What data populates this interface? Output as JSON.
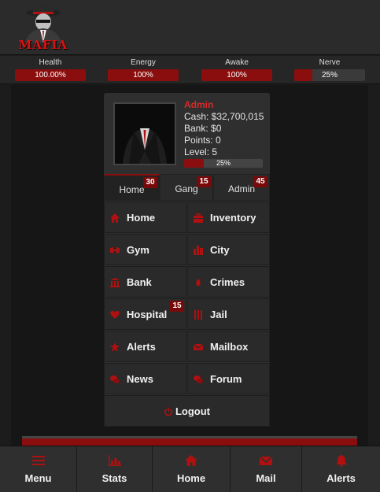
{
  "header": {
    "logo_text": "MAFIA"
  },
  "stats": [
    {
      "label": "Health",
      "value_text": "100.00%",
      "fill": 1.0
    },
    {
      "label": "Energy",
      "value_text": "100%",
      "fill": 1.0
    },
    {
      "label": "Awake",
      "value_text": "100%",
      "fill": 1.0
    },
    {
      "label": "Nerve",
      "value_text": "25%",
      "fill": 0.25
    }
  ],
  "profile": {
    "name": "Admin",
    "cash": "Cash: $32,700,015",
    "bank": "Bank: $0",
    "points": "Points: 0",
    "level": "Level: 5",
    "level_progress_text": "25%",
    "level_progress": 0.25
  },
  "tabs": [
    {
      "label": "Home",
      "badge": "30",
      "active": true
    },
    {
      "label": "Gang",
      "badge": "15",
      "active": false
    },
    {
      "label": "Admin",
      "badge": "45",
      "active": false
    }
  ],
  "menu": [
    {
      "label": "Home",
      "icon": "home-icon"
    },
    {
      "label": "Inventory",
      "icon": "briefcase-icon"
    },
    {
      "label": "Gym",
      "icon": "dumbbell-icon"
    },
    {
      "label": "City",
      "icon": "city-icon"
    },
    {
      "label": "Bank",
      "icon": "bank-icon"
    },
    {
      "label": "Crimes",
      "icon": "crime-icon"
    },
    {
      "label": "Hospital",
      "icon": "hospital-icon",
      "badge": "15"
    },
    {
      "label": "Jail",
      "icon": "jail-icon"
    },
    {
      "label": "Alerts",
      "icon": "alert-icon"
    },
    {
      "label": "Mailbox",
      "icon": "mail-icon"
    },
    {
      "label": "News",
      "icon": "news-icon"
    },
    {
      "label": "Forum",
      "icon": "forum-icon"
    }
  ],
  "logout": {
    "label": "Logout",
    "icon": "power-icon"
  },
  "bottom_nav": [
    {
      "label": "Menu",
      "icon": "menu-icon"
    },
    {
      "label": "Stats",
      "icon": "stats-icon"
    },
    {
      "label": "Home",
      "icon": "home-icon"
    },
    {
      "label": "Mail",
      "icon": "mail-icon"
    },
    {
      "label": "Alerts",
      "icon": "bell-icon"
    }
  ],
  "colors": {
    "accent": "#8a0e0e",
    "name": "#d62b2b",
    "background": "#1c1c1c"
  }
}
